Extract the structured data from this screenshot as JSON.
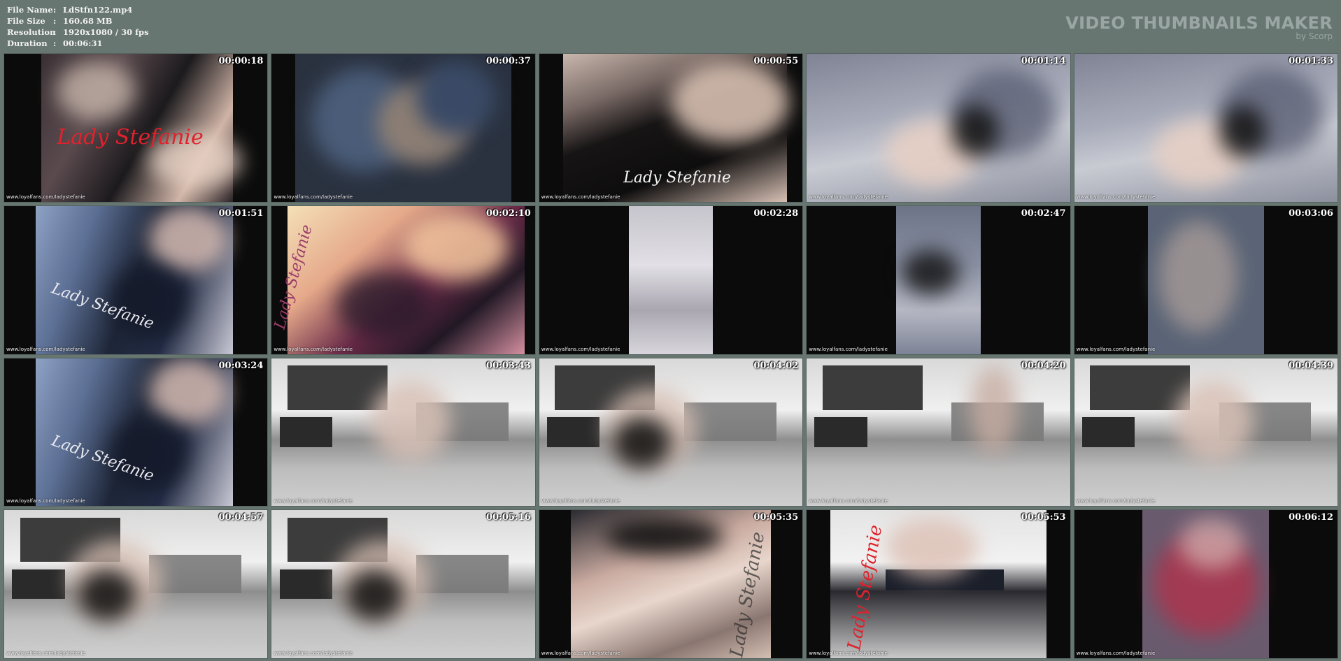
{
  "file_info": [
    {
      "label": "File Name",
      "value": "LdStfn122.mp4"
    },
    {
      "label": "File Size",
      "value": "160.68 MB"
    },
    {
      "label": "Resolution",
      "value": "1920x1080 / 30 fps"
    },
    {
      "label": "Duration",
      "value": "00:06:31"
    }
  ],
  "separator": ":",
  "brand": {
    "title": "VIDEO THUMBNAILS MAKER",
    "subtitle": "by Scorp"
  },
  "thumbnails": [
    {
      "time": "00:00:18",
      "watermark": "www.loyalfans.com/ladystefanie",
      "title": "Lady Stefanie",
      "title_color": "#e0222c",
      "scene": "portrait-dark"
    },
    {
      "time": "00:00:37",
      "watermark": "www.loyalfans.com/ladystefanie",
      "title": "",
      "title_color": "",
      "scene": "blurred"
    },
    {
      "time": "00:00:55",
      "watermark": "www.loyalfans.com/ladystefanie",
      "title": "Lady Stefanie",
      "title_color": "#f3f3f3",
      "scene": "reclining"
    },
    {
      "time": "00:01:14",
      "watermark": "www.loyalfans.com/ladystefanie",
      "title": "",
      "title_color": "",
      "scene": "floor-heels"
    },
    {
      "time": "00:01:33",
      "watermark": "www.loyalfans.com/ladystefanie",
      "title": "",
      "title_color": "",
      "scene": "floor-heels"
    },
    {
      "time": "00:01:51",
      "watermark": "www.loyalfans.com/ladystefanie",
      "title": "Lady Stefanie",
      "title_color": "#e8e8ee",
      "scene": "portrait-blue"
    },
    {
      "time": "00:02:10",
      "watermark": "www.loyalfans.com/ladystefanie",
      "title": "Lady Stefanie",
      "title_color": "#9a3b6a",
      "scene": "warm-car"
    },
    {
      "time": "00:02:28",
      "watermark": "www.loyalfans.com/ladystefanie",
      "title": "",
      "title_color": "",
      "scene": "vertical-floor"
    },
    {
      "time": "00:02:47",
      "watermark": "www.loyalfans.com/ladystefanie",
      "title": "",
      "title_color": "",
      "scene": "vertical-heel"
    },
    {
      "time": "00:03:06",
      "watermark": "www.loyalfans.com/ladystefanie",
      "title": "",
      "title_color": "",
      "scene": "vertical-blur"
    },
    {
      "time": "00:03:24",
      "watermark": "www.loyalfans.com/ladystefanie",
      "title": "Lady Stefanie",
      "title_color": "#e8e8ee",
      "scene": "portrait-blue"
    },
    {
      "time": "00:03:43",
      "watermark": "www.loyalfans.com/ladystefanie",
      "title": "",
      "title_color": "",
      "scene": "studio-feet"
    },
    {
      "time": "00:04:02",
      "watermark": "www.loyalfans.com/ladystefanie",
      "title": "",
      "title_color": "",
      "scene": "studio-heel"
    },
    {
      "time": "00:04:20",
      "watermark": "www.loyalfans.com/ladystefanie",
      "title": "",
      "title_color": "",
      "scene": "studio-walk"
    },
    {
      "time": "00:04:39",
      "watermark": "www.loyalfans.com/ladystefanie",
      "title": "",
      "title_color": "",
      "scene": "studio-feet"
    },
    {
      "time": "00:04:57",
      "watermark": "www.loyalfans.com/ladystefanie",
      "title": "",
      "title_color": "",
      "scene": "studio-heel"
    },
    {
      "time": "00:05:16",
      "watermark": "www.loyalfans.com/ladystefanie",
      "title": "",
      "title_color": "",
      "scene": "studio-heel"
    },
    {
      "time": "00:05:35",
      "watermark": "www.loyalfans.com/ladystefanie",
      "title": "Lady Stefanie",
      "title_color": "#2a2a2a",
      "scene": "closeup-toe"
    },
    {
      "time": "00:05:53",
      "watermark": "www.loyalfans.com/ladystefanie",
      "title": "Lady Stefanie",
      "title_color": "#e0222c",
      "scene": "bench"
    },
    {
      "time": "00:06:12",
      "watermark": "www.loyalfans.com/ladystefanie",
      "title": "",
      "title_color": "",
      "scene": "red-blur"
    }
  ]
}
